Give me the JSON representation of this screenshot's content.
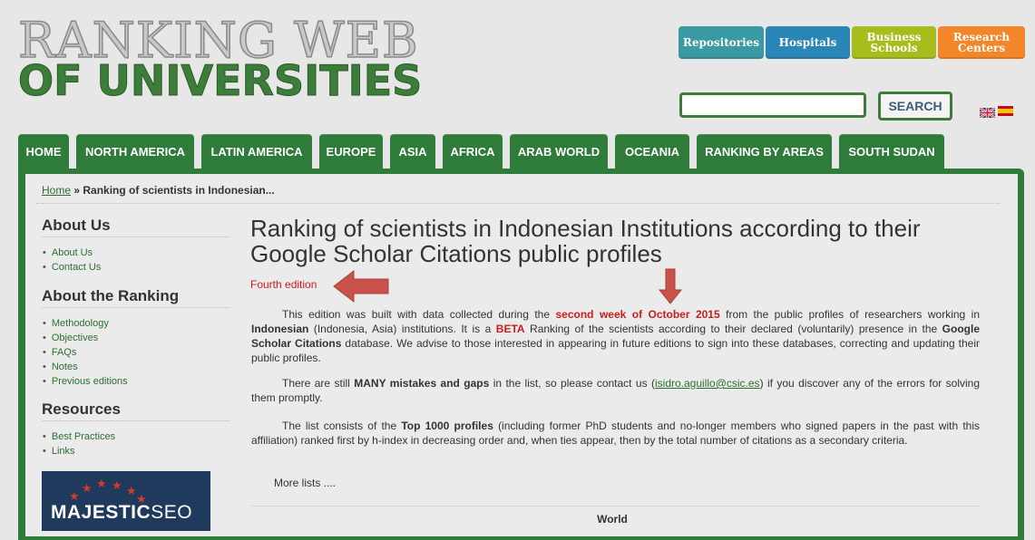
{
  "logo": {
    "line1": "RANKING WEB",
    "line2": "OF UNIVERSITIES"
  },
  "top_buttons": {
    "repositories": "Repositories",
    "hospitals": "Hospitals",
    "business_line1": "Business",
    "business_line2": "Schools",
    "research_line1": "Research",
    "research_line2": "Centers"
  },
  "search": {
    "value": "",
    "button": "SEARCH"
  },
  "flags": [
    "uk-flag-icon",
    "spain-flag-icon"
  ],
  "nav": [
    "HOME",
    "NORTH AMERICA",
    "LATIN AMERICA",
    "EUROPE",
    "ASIA",
    "AFRICA",
    "ARAB WORLD",
    "OCEANIA",
    "RANKING BY AREAS",
    "SOUTH SUDAN"
  ],
  "breadcrumb": {
    "home": "Home",
    "separator": " » ",
    "current": "Ranking of scientists in Indonesian..."
  },
  "sidebar": {
    "about_us": {
      "heading": "About Us",
      "items": [
        "About Us",
        "Contact Us"
      ]
    },
    "about_ranking": {
      "heading": "About the Ranking",
      "items": [
        "Methodology",
        "Objectives",
        "FAQs",
        "Notes",
        "Previous editions"
      ]
    },
    "resources": {
      "heading": "Resources",
      "items": [
        "Best Practices",
        "Links"
      ]
    },
    "banner": {
      "brand": "MAJESTIC",
      "suffix": "SEO"
    }
  },
  "main": {
    "title": "Ranking of scientists in Indonesian Institutions according to their Google Scholar Citations public profiles",
    "edition": "Fourth edition",
    "p1": {
      "a": "This edition was built with data collected during the ",
      "b": "second week of October 2015",
      "c": " from the public profiles of researchers working in ",
      "d": "Indonesian",
      "e": " (Indonesia, Asia) institutions. It is a ",
      "f": "BETA",
      "g": " Ranking of the scientists according to their declared (voluntarily) presence in the ",
      "h": "Google Scholar Citations",
      "i": " database. We advise to those interested in appearing in future editions to sign into these databases, correcting and updating their public profiles."
    },
    "p2": {
      "a": "There are still ",
      "b": "MANY mistakes and gaps",
      "c": " in the list, so please contact us (",
      "d": "isidro.aguillo@csic.es",
      "e": ") if you discover any of the errors for solving them promptly."
    },
    "p3": {
      "a": "The list consists of the ",
      "b": "Top 1000 profiles",
      "c": " (including former PhD students and no-longer members who signed papers in the past with this affiliation) ranked first by h-index in decreasing order and, when ties appear, then by the total number of citations as a secondary criteria."
    },
    "more_lists": "More lists ....",
    "world": "World"
  },
  "colors": {
    "nav_green": "#2e7b3a",
    "link_green": "#2a6f2f",
    "accent_red": "#cc1c1c",
    "arrow_red": "#c9524b"
  }
}
